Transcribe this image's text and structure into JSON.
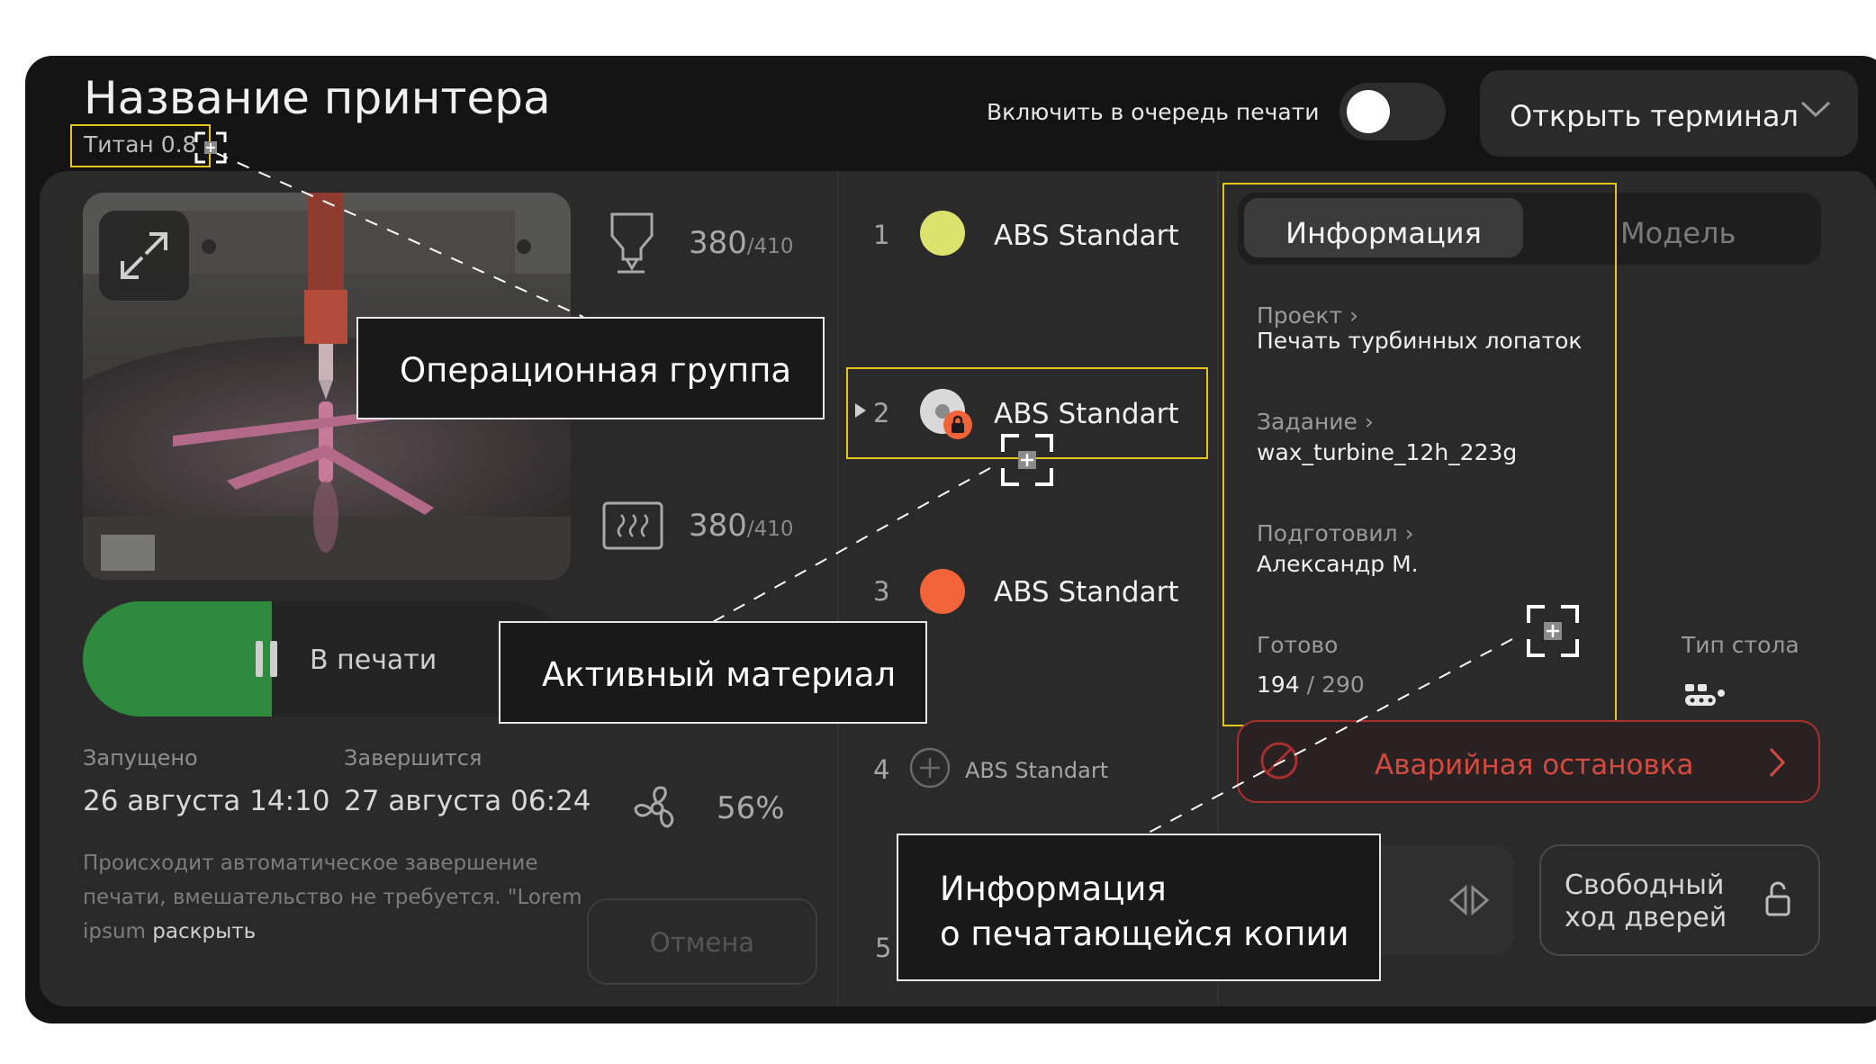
{
  "header": {
    "printer_name": "Название принтера",
    "printer_model": "Титан 0.8",
    "queue_toggle_label": "Включить в очередь печати",
    "queue_toggle_on": false,
    "terminal_button_label": "Открыть терминал"
  },
  "controls": {
    "nozzle_temp": {
      "icon": "nozzle-icon",
      "current": "380",
      "max": "/410"
    },
    "bed_temp": {
      "icon": "heatbed-icon",
      "current": "380",
      "max": "/410"
    },
    "fan": {
      "icon": "fan-icon",
      "value": "56%"
    },
    "print_status_label": "В печати",
    "started_label": "Запущено",
    "started_value": "26 августа 14:10",
    "ends_label": "Завершится",
    "ends_value": "27 августа 06:24",
    "description": "Происходит автоматическое завершение печати, вмешательство не требуется. \"Lorem ipsum",
    "description_link": "раскрыть",
    "cancel_label": "Отмена"
  },
  "materials": [
    {
      "num": "1",
      "name": "ABS Standart",
      "color": "#dce36c"
    },
    {
      "num": "2",
      "name": "ABS Standart",
      "color": "#d9d9d9",
      "active": true,
      "locked": true
    },
    {
      "num": "3",
      "name": "ABS Standart",
      "color": "#f2633a"
    },
    {
      "num": "4",
      "name": "ABS Standart",
      "empty": true
    },
    {
      "num": "5",
      "name": ""
    }
  ],
  "info": {
    "tabs": [
      "Информация",
      "Модель"
    ],
    "active_tab": "Информация",
    "project_label": "Проект",
    "project_value": "Печать турбинных лопаток",
    "task_label": "Задание",
    "task_value": "wax_turbine_12h_223g",
    "prepared_label": "Подготовил",
    "prepared_value": "Александр М.",
    "ready_label": "Готово",
    "ready_done": "194",
    "ready_sep": "/",
    "ready_total": "290",
    "table_type_label": "Тип стола"
  },
  "actions": {
    "emergency_stop_label": "Аварийная остановка",
    "door_label": "Свободный ход дверей"
  },
  "callouts": {
    "operational_group": "Операционная группа",
    "active_material": "Активный материал",
    "copy_info_line1": "Информация",
    "copy_info_line2": "о печатающейся копии"
  },
  "colors": {
    "accent_yellow": "#e6c41e",
    "status_green": "#2e8b3e",
    "danger_red": "#d34a3f",
    "lock_orange": "#f2633a"
  }
}
